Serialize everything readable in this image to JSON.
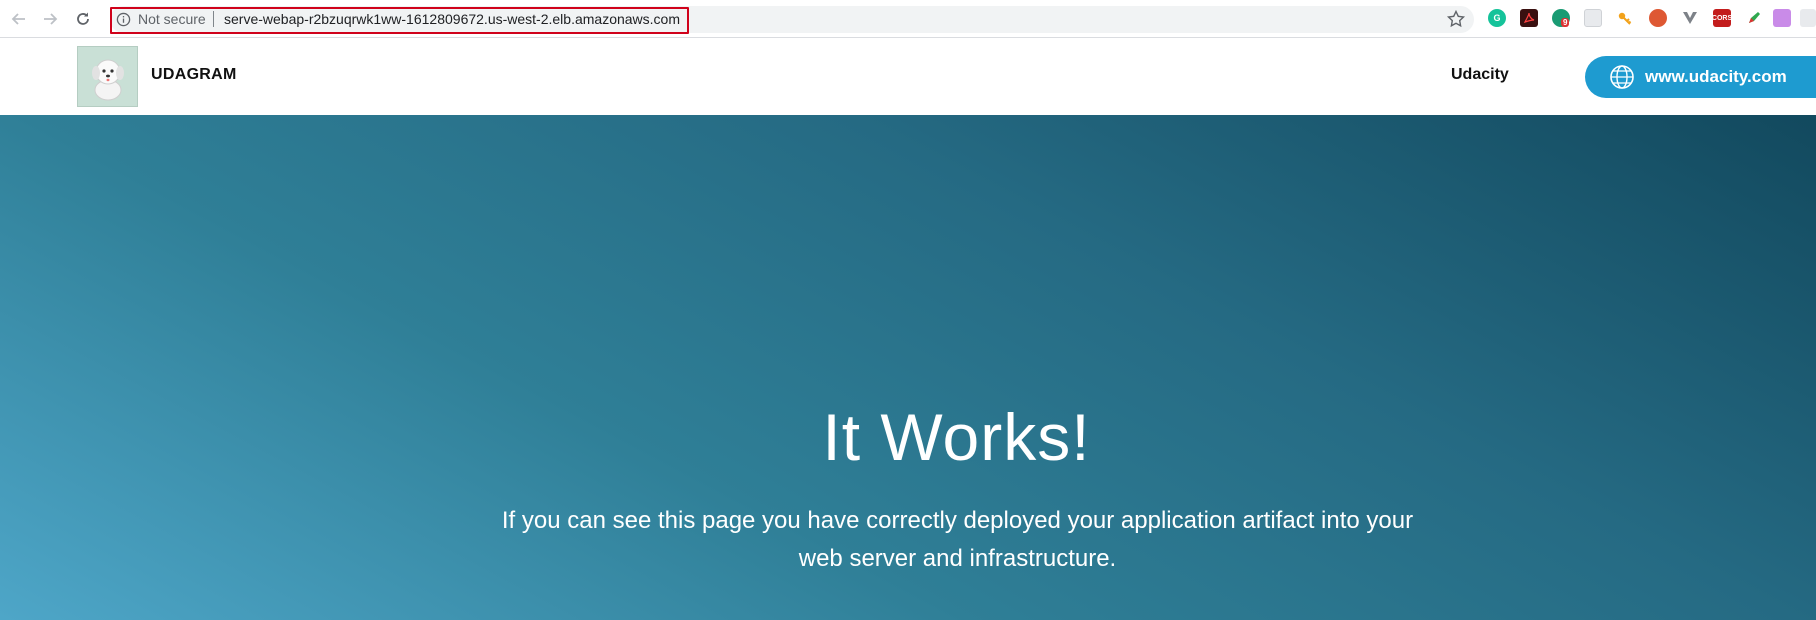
{
  "browser": {
    "security_label": "Not secure",
    "url": "serve-webap-r2bzuqrwk1ww-1612809672.us-west-2.elb.amazonaws.com",
    "extension_badge": "9",
    "cors_label": "CORS"
  },
  "site": {
    "brand": "UDAGRAM",
    "nav_link": "Udacity",
    "cta_label": "www.udacity.com"
  },
  "hero": {
    "title": "It Works!",
    "subtitle": "If you can see this page you have correctly deployed your application artifact into your web server and infrastructure."
  },
  "colors": {
    "cta": "#1e9bd0",
    "hero_start": "#4ea6c8",
    "hero_end": "#12495e",
    "url_highlight": "#d0021b"
  }
}
